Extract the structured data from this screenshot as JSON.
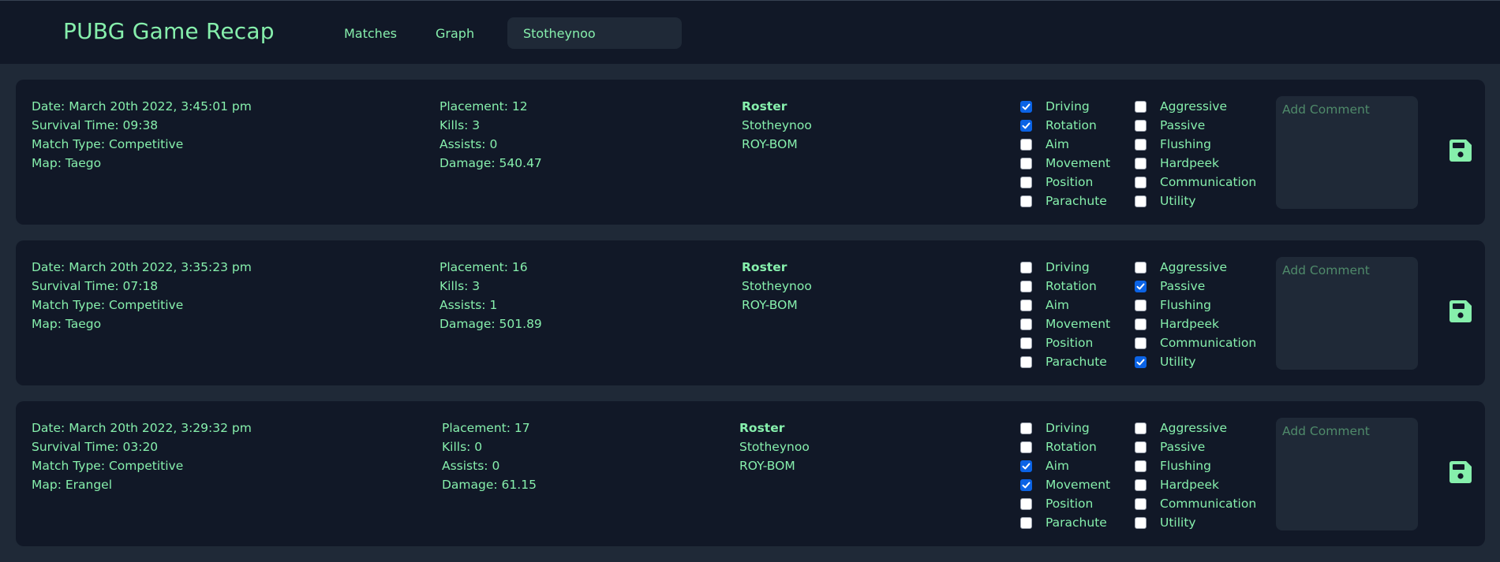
{
  "header": {
    "title": "PUBG Game Recap",
    "nav": [
      "Matches",
      "Graph"
    ],
    "search_value": "Stotheynoo"
  },
  "tag_labels_left": [
    "Driving",
    "Rotation",
    "Aim",
    "Movement",
    "Position",
    "Parachute"
  ],
  "tag_labels_right": [
    "Aggressive",
    "Passive",
    "Flushing",
    "Hardpeek",
    "Communication",
    "Utility"
  ],
  "comment_placeholder": "Add Comment",
  "roster_heading": "Roster",
  "matches": [
    {
      "date": "Date: March 20th 2022, 3:45:01 pm",
      "survival": "Survival Time: 09:38",
      "match_type": "Match Type: Competitive",
      "map": "Map: Taego",
      "placement": "Placement: 12",
      "kills": "Kills: 3",
      "assists": "Assists: 0",
      "damage": "Damage: 540.47",
      "roster": [
        "Stotheynoo",
        "ROY-BOM"
      ],
      "checked_left": [
        true,
        true,
        false,
        false,
        false,
        false
      ],
      "checked_right": [
        false,
        false,
        false,
        false,
        false,
        false
      ]
    },
    {
      "date": "Date: March 20th 2022, 3:35:23 pm",
      "survival": "Survival Time: 07:18",
      "match_type": "Match Type: Competitive",
      "map": "Map: Taego",
      "placement": "Placement: 16",
      "kills": "Kills: 3",
      "assists": "Assists: 1",
      "damage": "Damage: 501.89",
      "roster": [
        "Stotheynoo",
        "ROY-BOM"
      ],
      "checked_left": [
        false,
        false,
        false,
        false,
        false,
        false
      ],
      "checked_right": [
        false,
        true,
        false,
        false,
        false,
        true
      ]
    },
    {
      "date": "Date: March 20th 2022, 3:29:32 pm",
      "survival": "Survival Time: 03:20",
      "match_type": "Match Type: Competitive",
      "map": "Map: Erangel",
      "placement": "Placement: 17",
      "kills": "Kills: 0",
      "assists": "Assists: 0",
      "damage": "Damage: 61.15",
      "roster": [
        "Stotheynoo",
        "ROY-BOM"
      ],
      "checked_left": [
        false,
        false,
        true,
        true,
        false,
        false
      ],
      "checked_right": [
        false,
        false,
        false,
        false,
        false,
        false
      ]
    }
  ],
  "colors": {
    "accent": "#86efac",
    "background": "#1f2937",
    "card": "#111827",
    "checkbox_checked": "#0b63e5"
  },
  "icons": {
    "save": "floppy-disk-icon",
    "check": "checkmark-icon"
  }
}
